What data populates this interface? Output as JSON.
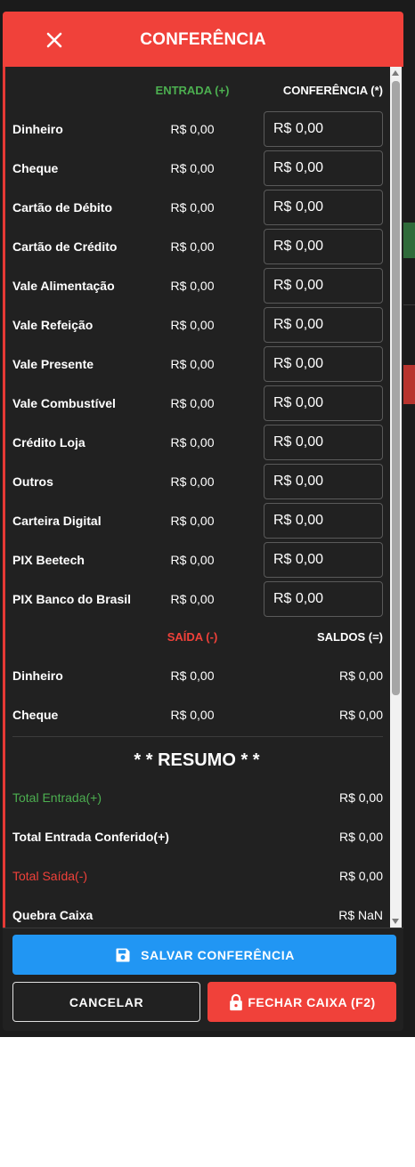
{
  "dialog": {
    "title": "CONFERÊNCIA",
    "close_icon": "close-icon"
  },
  "columns": {
    "entrada": "ENTRADA (+)",
    "conferencia": "CONFERÊNCIA (*)",
    "saida": "SAÍDA (-)",
    "saldos": "SALDOS (=)"
  },
  "entries": [
    {
      "label": "Dinheiro",
      "entrada": "R$ 0,00",
      "conferencia": "R$ 0,00"
    },
    {
      "label": "Cheque",
      "entrada": "R$ 0,00",
      "conferencia": "R$ 0,00"
    },
    {
      "label": "Cartão de Débito",
      "entrada": "R$ 0,00",
      "conferencia": "R$ 0,00"
    },
    {
      "label": "Cartão de Crédito",
      "entrada": "R$ 0,00",
      "conferencia": "R$ 0,00"
    },
    {
      "label": "Vale Alimentação",
      "entrada": "R$ 0,00",
      "conferencia": "R$ 0,00"
    },
    {
      "label": "Vale Refeição",
      "entrada": "R$ 0,00",
      "conferencia": "R$ 0,00"
    },
    {
      "label": "Vale Presente",
      "entrada": "R$ 0,00",
      "conferencia": "R$ 0,00"
    },
    {
      "label": "Vale Combustível",
      "entrada": "R$ 0,00",
      "conferencia": "R$ 0,00"
    },
    {
      "label": "Crédito Loja",
      "entrada": "R$ 0,00",
      "conferencia": "R$ 0,00"
    },
    {
      "label": "Outros",
      "entrada": "R$ 0,00",
      "conferencia": "R$ 0,00"
    },
    {
      "label": "Carteira Digital",
      "entrada": "R$ 0,00",
      "conferencia": "R$ 0,00"
    },
    {
      "label": "PIX Beetech",
      "entrada": "R$ 0,00",
      "conferencia": "R$ 0,00"
    },
    {
      "label": "PIX Banco do Brasil",
      "entrada": "R$ 0,00",
      "conferencia": "R$ 0,00"
    }
  ],
  "exits": [
    {
      "label": "Dinheiro",
      "saida": "R$ 0,00",
      "saldo": "R$ 0,00"
    },
    {
      "label": "Cheque",
      "saida": "R$ 0,00",
      "saldo": "R$ 0,00"
    }
  ],
  "resumo": {
    "title": "* * RESUMO * *",
    "rows": [
      {
        "label": "Total Entrada(+)",
        "value": "R$ 0,00"
      },
      {
        "label": "Total Entrada Conferido(+)",
        "value": "R$ 0,00"
      },
      {
        "label": "Total Saída(-)",
        "value": "R$ 0,00"
      },
      {
        "label": "Quebra Caixa",
        "value": "R$ NaN"
      }
    ]
  },
  "buttons": {
    "save": "SALVAR CONFERÊNCIA",
    "cancel": "CANCELAR",
    "close_cash": "FECHAR CAIXA (F2)"
  },
  "colors": {
    "header": "#f0413a",
    "entrada": "#4caf50",
    "saida": "#f0413a",
    "save_button": "#2196f3",
    "background": "#212121"
  },
  "icons": {
    "save": "floppy-disk-icon",
    "close_cash": "lock-icon"
  }
}
